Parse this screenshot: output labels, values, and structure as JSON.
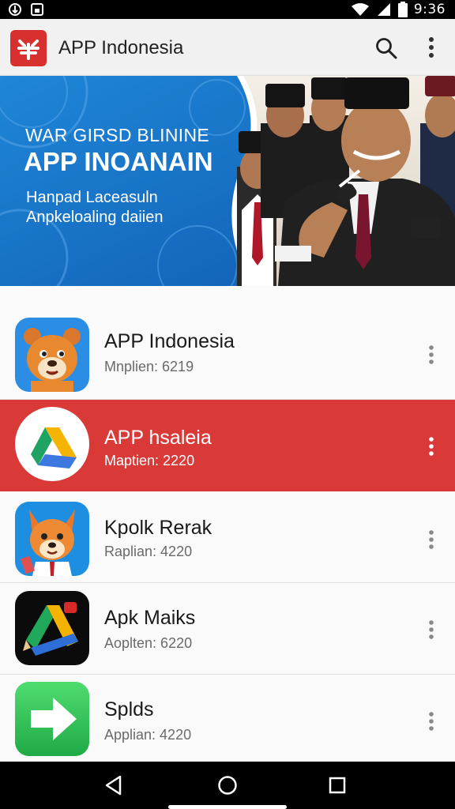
{
  "status_bar": {
    "time": "9:36",
    "icons": [
      "usb-debug-icon",
      "screenshot-icon",
      "wifi-icon",
      "signal-icon",
      "battery-icon"
    ]
  },
  "app_bar": {
    "title": "APP Indonesia",
    "logo": "app-logo-icon",
    "actions": [
      "search-icon",
      "more-vert-icon"
    ]
  },
  "banner": {
    "line1": "WAR GIRSD BLININE",
    "line2": "APP INOANAIN",
    "line3": "Hanpad Laceasuln Anpkeloaling daiien",
    "background_color": "#1a73c8"
  },
  "list": {
    "items": [
      {
        "name": "APP Indonesia",
        "meta": "Mnplien: 6219",
        "icon": "bear-mascot-icon",
        "selected": false
      },
      {
        "name": "APP hsaleia",
        "meta": "Maptien: 2220",
        "icon": "drive-triangle-icon",
        "selected": true
      },
      {
        "name": "Kpolk Rerak",
        "meta": "Raplian: 4220",
        "icon": "fox-mascot-icon",
        "selected": false
      },
      {
        "name": "Apk Maiks",
        "meta": "Aoplten: 6220",
        "icon": "triangle-pencil-icon",
        "selected": false
      },
      {
        "name": "Splds",
        "meta": "Applian: 4220",
        "icon": "green-arrow-icon",
        "selected": false
      }
    ],
    "selected_color": "#d93a38"
  },
  "nav_bar": {
    "buttons": [
      "back-icon",
      "home-icon",
      "recents-icon"
    ]
  }
}
